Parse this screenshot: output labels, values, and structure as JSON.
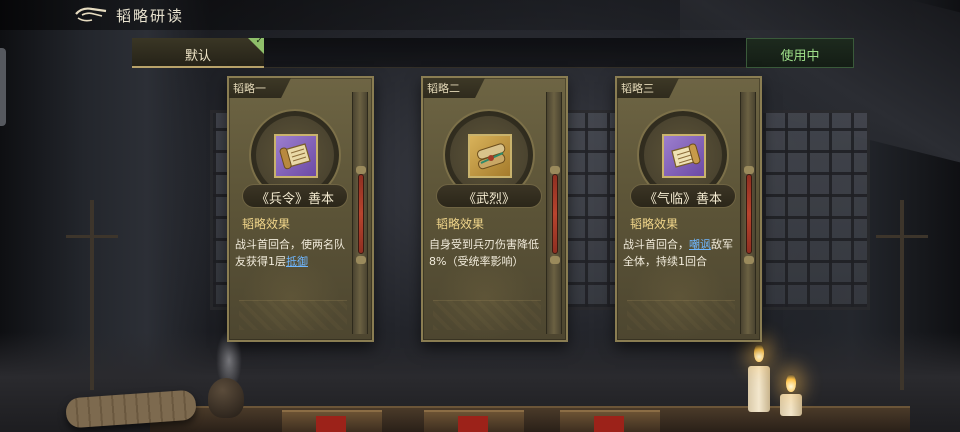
{
  "header": {
    "title": "韬略研读",
    "back_icon": "back-arrow-icon"
  },
  "strategy_bar": {
    "preset_label": "默认",
    "preset_selected": true,
    "status_label": "使用中",
    "status_color": "#9fe08a"
  },
  "cards": [
    {
      "slot": "韬略一",
      "name": "《兵令》善本",
      "icon": "scroll-icon",
      "icon_bg": "purple",
      "effect_title": "韬略效果",
      "effect_text": "战斗首回合，使两名队友获得1层",
      "effect_link": "抵御",
      "effect_suffix": ""
    },
    {
      "slot": "韬略二",
      "name": "《武烈》",
      "icon": "scroll-icon",
      "icon_bg": "gold",
      "effect_title": "韬略效果",
      "effect_text": "自身受到兵刃伤害降低8%（受统率影响）",
      "effect_link": "",
      "effect_suffix": ""
    },
    {
      "slot": "韬略三",
      "name": "《气临》善本",
      "icon": "scroll-icon",
      "icon_bg": "purple",
      "effect_title": "韬略效果",
      "effect_text": "战斗首回合，",
      "effect_link": "嘲讽",
      "effect_suffix": "敌军全体，持续1回合"
    }
  ],
  "colors": {
    "accent_gold": "#f0d58a",
    "link_blue": "#6fb7ff",
    "card_bg": "#5d5538"
  }
}
